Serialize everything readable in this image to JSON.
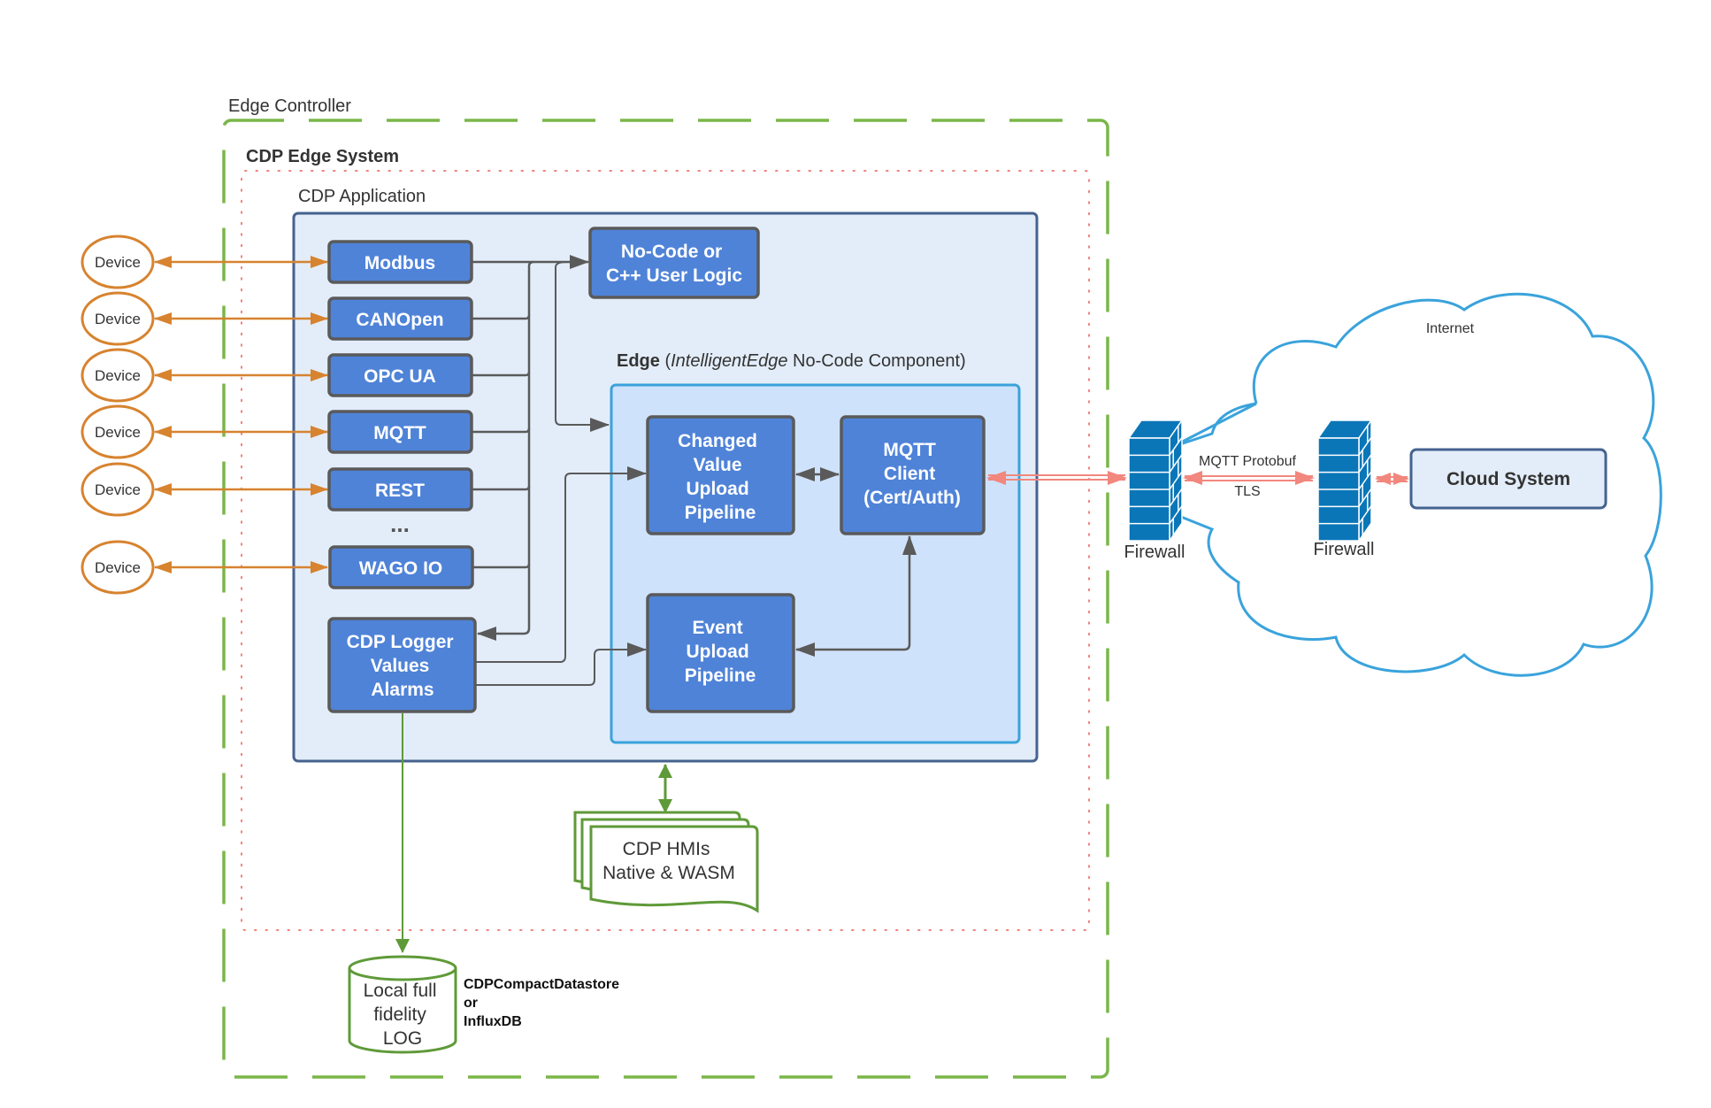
{
  "colors": {
    "box_fill": "#4f83d8",
    "box_stroke": "#5a5a5a",
    "app_fill": "#e3edf9",
    "app_stroke": "#45628f",
    "edge_fill": "#cfe2fb",
    "edge_stroke": "#3aa3db",
    "controller_dash": "#7ab648",
    "system_dots": "#f2827a",
    "device_stroke": "#d7832f",
    "device_arrow": "#d7832f",
    "connector": "#5a5a5a",
    "secure_link": "#f2877e",
    "green_link": "#5f9a38",
    "cloud_stroke": "#3aa3db",
    "firewall": "#0a76b8",
    "cloud_system_fill": "#e3edf9"
  },
  "containers": {
    "edge_controller": "Edge Controller",
    "cdp_edge_system": "CDP Edge System",
    "cdp_application": "CDP Application",
    "edge_component": {
      "bold": "Edge",
      "open": " (",
      "italic": "IntelligentEdge",
      "rest": " No-Code Component)"
    }
  },
  "devices": [
    "Device",
    "Device",
    "Device",
    "Device",
    "Device",
    "Device"
  ],
  "protocols": [
    "Modbus",
    "CANOpen",
    "OPC UA",
    "MQTT",
    "REST",
    "WAGO IO"
  ],
  "ellipsis": "...",
  "user_logic": [
    "No-Code or",
    "C++ User Logic"
  ],
  "logger": [
    "CDP Logger",
    "Values",
    "Alarms"
  ],
  "changed_value_pipeline": [
    "Changed",
    "Value",
    "Upload",
    "Pipeline"
  ],
  "mqtt_client": [
    "MQTT",
    "Client",
    "(Cert/Auth)"
  ],
  "event_pipeline": [
    "Event",
    "Upload",
    "Pipeline"
  ],
  "hmis": [
    "CDP HMIs",
    "Native & WASM"
  ],
  "log_store": [
    "Local full",
    "fidelity",
    "LOG"
  ],
  "log_store_note": [
    "CDPCompactDatastore",
    "or",
    "InfluxDB"
  ],
  "internet": {
    "label": "Internet",
    "firewall_left": "Firewall",
    "firewall_right": "Firewall",
    "link_top": "MQTT Protobuf",
    "link_bottom": "TLS",
    "cloud_system": "Cloud System"
  }
}
